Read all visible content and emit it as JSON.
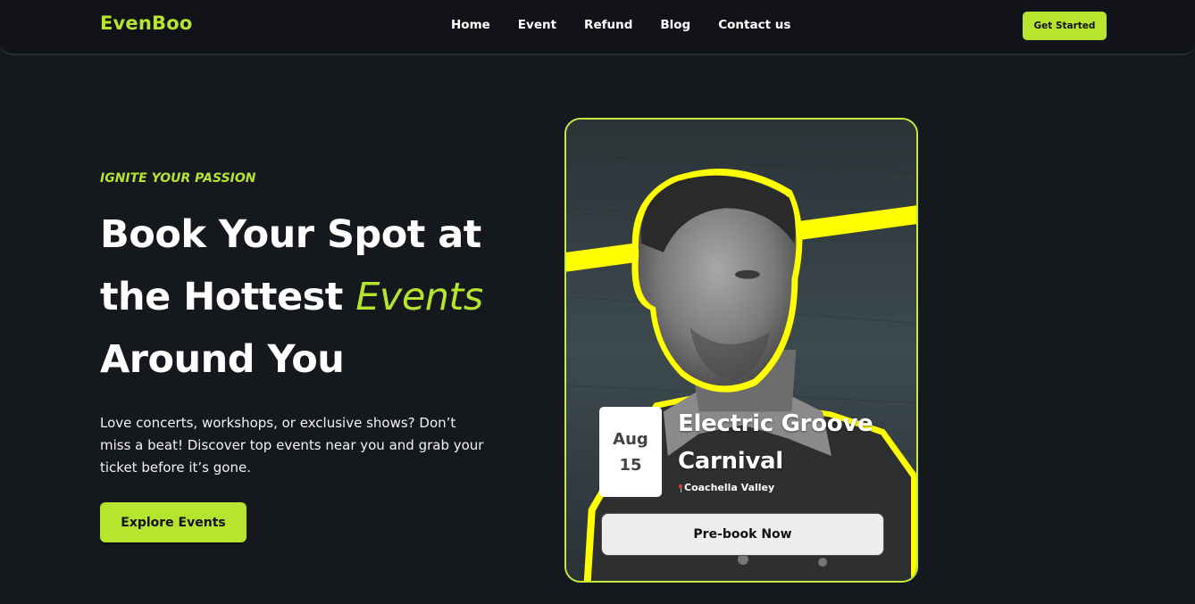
{
  "header": {
    "logo": "EvenBoo",
    "nav": [
      "Home",
      "Event",
      "Refund",
      "Blog",
      "Contact us"
    ],
    "cta_label": "Get Started"
  },
  "hero": {
    "eyebrow": "IGNITE YOUR PASSION",
    "headline_line1": "Book Your Spot at",
    "headline_line2_prefix": "the Hottest ",
    "headline_line2_accent": "Events",
    "headline_line3": "Around You",
    "description": "Love concerts, workshops, or exclusive shows? Don’t miss a beat! Discover top events near you and grab your ticket before it’s gone.",
    "button_label": "Explore Events"
  },
  "event_card": {
    "month": "Aug",
    "day": "15",
    "title": "Electric Groove Carnival",
    "location": "Coachella Valley",
    "location_icon": "map-pin-icon",
    "button_label": "Pre-book Now"
  },
  "colors": {
    "accent": "#b5e52e",
    "background": "#15181d",
    "stripe": "#ffff00"
  }
}
